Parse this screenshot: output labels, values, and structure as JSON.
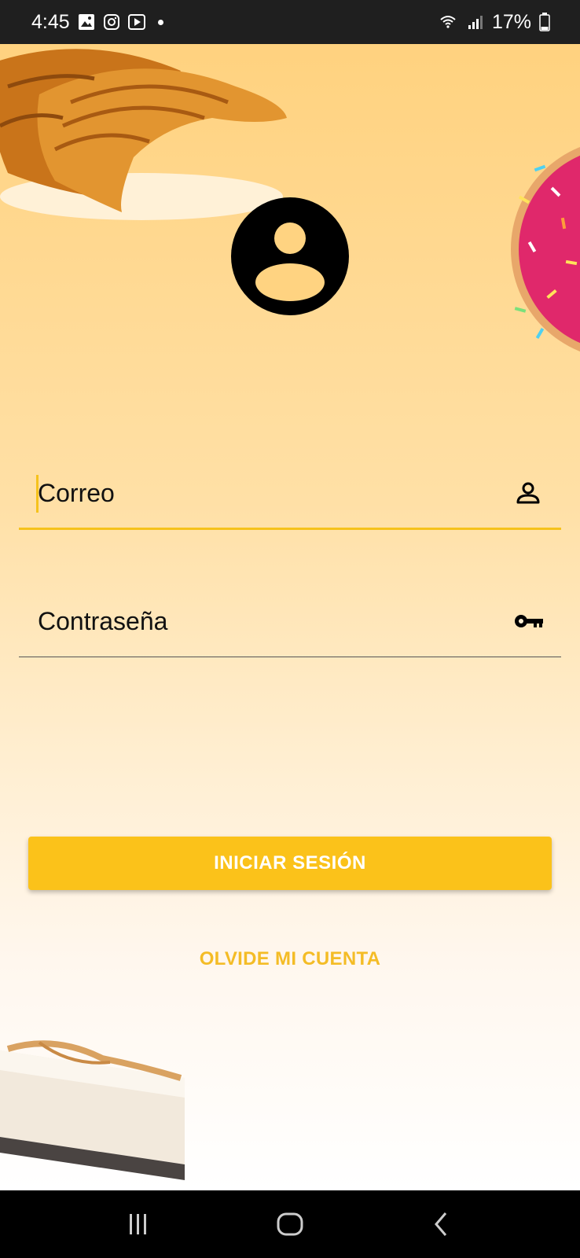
{
  "status_bar": {
    "time": "4:45",
    "battery": "17%",
    "left_icons": [
      "gallery-icon",
      "instagram-icon",
      "youtube-icon"
    ],
    "right_icons": [
      "wifi-icon",
      "signal-icon",
      "battery-icon"
    ]
  },
  "form": {
    "email_label": "Correo",
    "email_icon": "person-icon",
    "password_label": "Contraseña",
    "password_icon": "key-icon"
  },
  "buttons": {
    "login_label": "INICIAR SESIÓN",
    "forgot_label": "OLVIDE MI CUENTA"
  },
  "colors": {
    "accent": "#fbc21a",
    "link": "#f4bc26",
    "gradient_top": "#ffd27f",
    "gradient_bottom": "#ffffff"
  },
  "nav_bar": {
    "buttons": [
      "recents-icon",
      "home-icon",
      "back-icon"
    ]
  }
}
